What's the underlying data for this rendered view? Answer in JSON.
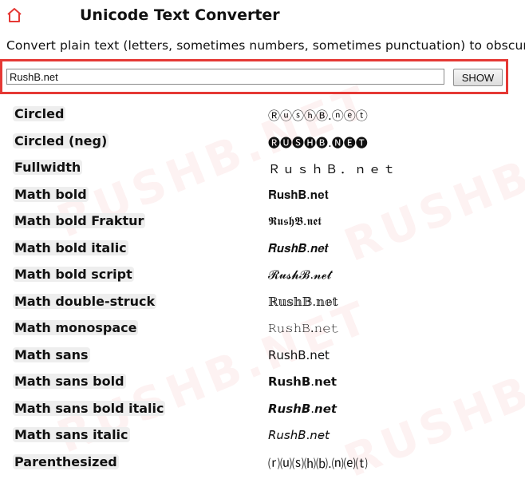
{
  "header": {
    "home_icon": "home-icon",
    "title": "Unicode Text Converter"
  },
  "description": "Convert plain text (letters, sometimes numbers, sometimes punctuation) to obscure",
  "input": {
    "value": "RushB.net",
    "button_label": "SHOW"
  },
  "highlight_color": "#e53935",
  "watermark_text": "RUSHB.NET",
  "results": [
    {
      "label": "Circled",
      "value": "ⓇⓤⓢⓗⒷ.ⓝⓔⓣ"
    },
    {
      "label": "Circled (neg)",
      "value": "🅡🅤🅢🅗🅑.🅝🅔🅣"
    },
    {
      "label": "Fullwidth",
      "value": "ＲｕｓｈＢ．ｎｅｔ"
    },
    {
      "label": "Math bold",
      "value": "𝐑𝐮𝐬𝐡𝐁.𝐧𝐞𝐭"
    },
    {
      "label": "Math bold Fraktur",
      "value": "𝕽𝖚𝖘𝖍𝕭.𝖓𝖊𝖙"
    },
    {
      "label": "Math bold italic",
      "value": "𝑹𝒖𝒔𝒉𝑩.𝒏𝒆𝒕"
    },
    {
      "label": "Math bold script",
      "value": "𝓡𝓾𝓼𝓱𝓑.𝓷𝓮𝓽"
    },
    {
      "label": "Math double-struck",
      "value": "ℝ𝕦𝕤𝕙𝔹.𝕟𝕖𝕥"
    },
    {
      "label": "Math monospace",
      "value": "𝚁𝚞𝚜𝚑𝙱.𝚗𝚎𝚝"
    },
    {
      "label": "Math sans",
      "value": "𝖱𝗎𝗌𝗁𝖡.𝗇𝖾𝗍"
    },
    {
      "label": "Math sans bold",
      "value": "𝗥𝘂𝘀𝗵𝗕.𝗻𝗲𝘁"
    },
    {
      "label": "Math sans bold italic",
      "value": "𝙍𝙪𝙨𝙝𝘽.𝙣𝙚𝙩"
    },
    {
      "label": "Math sans italic",
      "value": "𝘙𝘶𝘴𝘩𝘉.𝘯𝘦𝘵"
    },
    {
      "label": "Parenthesized",
      "value": "⒭⒰⒮⒣⒝.⒩⒠⒯"
    }
  ]
}
